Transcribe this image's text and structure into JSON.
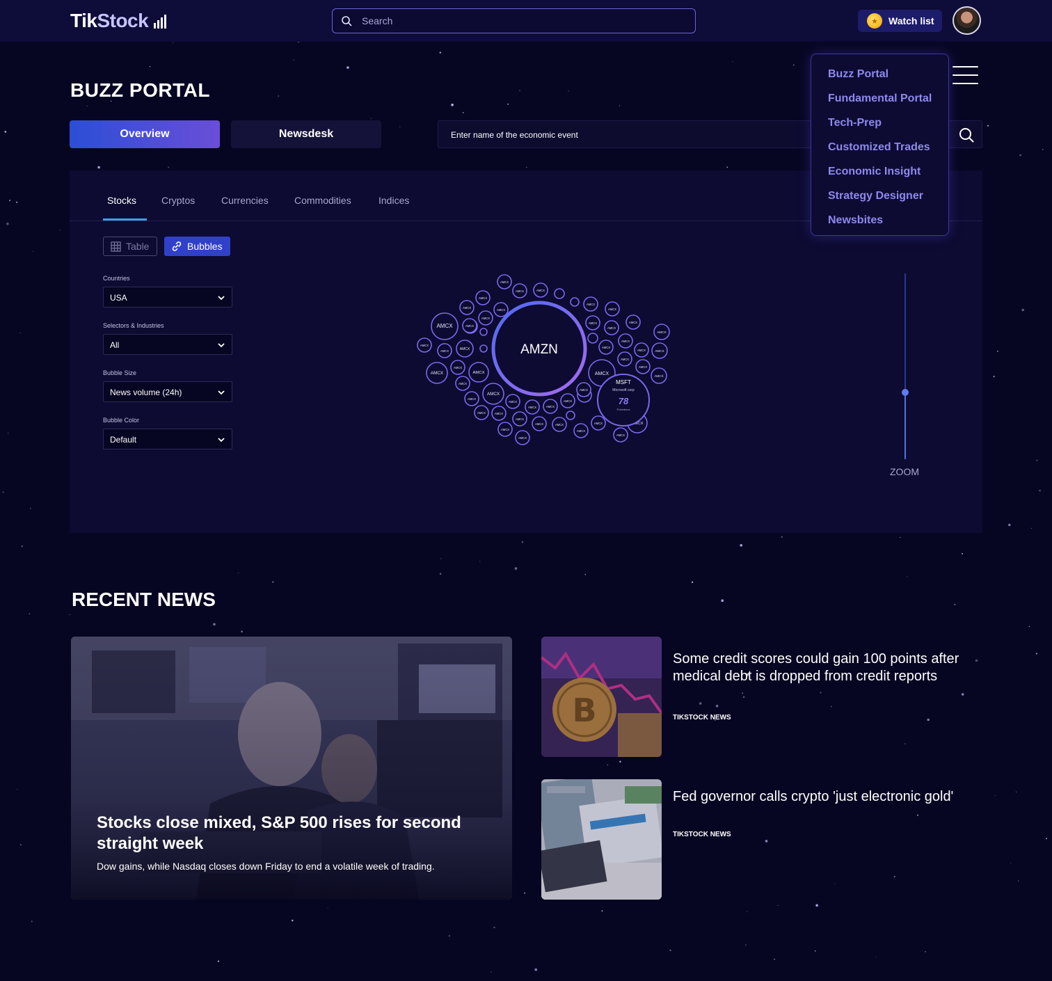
{
  "brand": {
    "logo_part1": "Tik",
    "logo_part2": "Stock"
  },
  "header": {
    "search_placeholder": "Search",
    "watchlist_label": "Watch list"
  },
  "page": {
    "title": "BUZZ PORTAL",
    "tabs": [
      "Overview",
      "Newsdesk"
    ],
    "event_search_placeholder": "Enter name of the economic event"
  },
  "nav_menu": {
    "items": [
      "Buzz Portal",
      "Fundamental Portal",
      "Tech-Prep",
      "Customized Trades",
      "Economic Insight",
      "Strategy Designer",
      "Newsbites"
    ]
  },
  "panel": {
    "asset_tabs": [
      "Stocks",
      "Cryptos",
      "Currencies",
      "Commodities",
      "Indices"
    ],
    "active_asset_tab": "Stocks",
    "view_toggle": {
      "table": "Table",
      "bubbles": "Bubbles",
      "active": "Bubbles"
    },
    "filters": [
      {
        "label": "Countries",
        "value": "USA"
      },
      {
        "label": "Selectors & Industries",
        "value": "All"
      },
      {
        "label": "Bubble Size",
        "value": "News volume (24h)"
      },
      {
        "label": "Bubble Color",
        "value": "Default"
      }
    ],
    "bubbles": {
      "center_label": "AMZN",
      "small_label": "AMCX",
      "highlight": {
        "ticker": "MSFT",
        "name": "Microsoft corp",
        "score": "78",
        "sub": "Pobedions"
      }
    },
    "zoom": {
      "label": "ZOOM",
      "level": 0.36
    }
  },
  "news": {
    "section_title": "RECENT NEWS",
    "feature": {
      "headline": "Stocks close mixed, S&P 500 rises for second straight week",
      "summary": "Dow gains, while Nasdaq closes down Friday to end a volatile week of trading."
    },
    "items": [
      {
        "headline": "Some credit scores could gain 100 points after medical debt is dropped from credit reports",
        "source": "TIKSTOCK NEWS"
      },
      {
        "headline": "Fed governor calls crypto 'just electronic gold'",
        "source": "TIKSTOCK NEWS"
      }
    ]
  },
  "colors": {
    "accent": "#3140c8",
    "menu_text": "#8e89ee",
    "bubble_stroke": "#7b68ee",
    "background": "#070622"
  }
}
